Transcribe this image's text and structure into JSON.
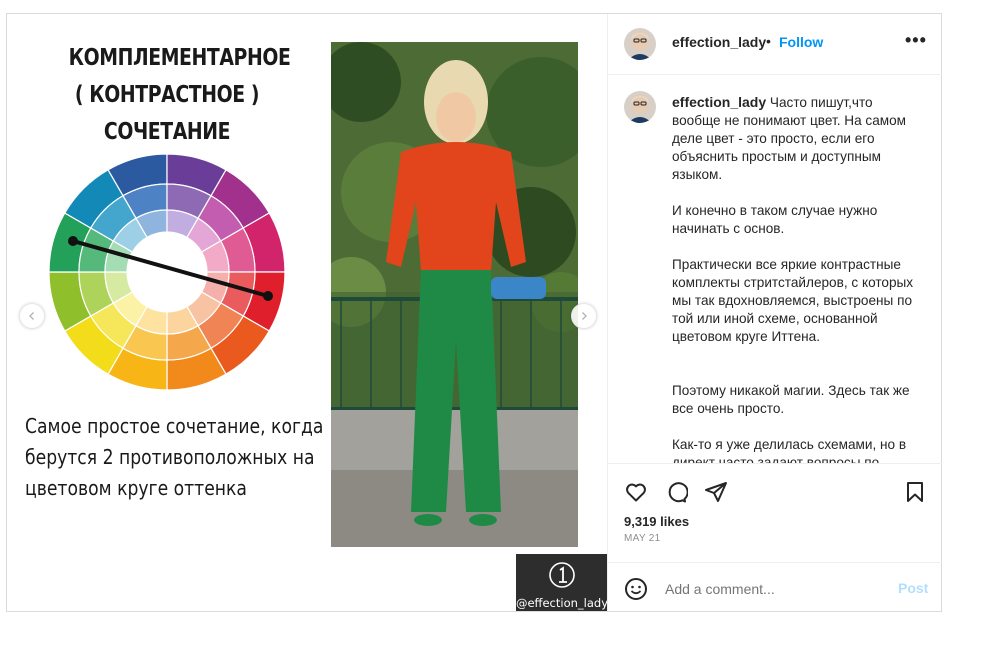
{
  "slide": {
    "title_lines": [
      "КОМПЛЕМЕНТАРНОЕ",
      "( КОНТРАСТНОЕ )",
      "СОЧЕТАНИЕ"
    ],
    "caption_lines": [
      "Самое простое сочетание, когда",
      "берутся 2 противоположных на",
      "цветовом круге оттенка"
    ],
    "watermark": "@effection_lady",
    "watermark_number": "1"
  },
  "post": {
    "username": "effection_lady",
    "separator": "•",
    "follow_label": "Follow",
    "more_label": "•••",
    "caption_username": "effection_lady",
    "caption_paragraphs": [
      "Часто пишут,что вообще не понимают цвет. На самом деле цвет - это просто, если его объяснить простым и доступным языком.",
      "И конечно в таком случае нужно начинать с основ.",
      "Практически все яркие контрастные комплекты стритстайлеров, с которых мы так вдохновляемся, выстроены по той или иной схеме, основанной цветовом круге Иттена.",
      "Поэтому никакой магии. Здесь так же все очень просто.",
      "Как-то я уже делилась схемами, но в директ часто задают вопросы по"
    ],
    "likes": "9,319 likes",
    "date": "MAY 21",
    "comment_placeholder": "Add a comment...",
    "post_label": "Post"
  },
  "icons": [
    "heart-icon",
    "comment-icon",
    "share-icon",
    "bookmark-icon",
    "emoji-icon",
    "chevron-left-icon",
    "chevron-right-icon",
    "more-icon"
  ],
  "colors": {
    "follow": "#0095f6",
    "post_disabled": "#b2dffc",
    "muted": "#8e8e8e"
  }
}
